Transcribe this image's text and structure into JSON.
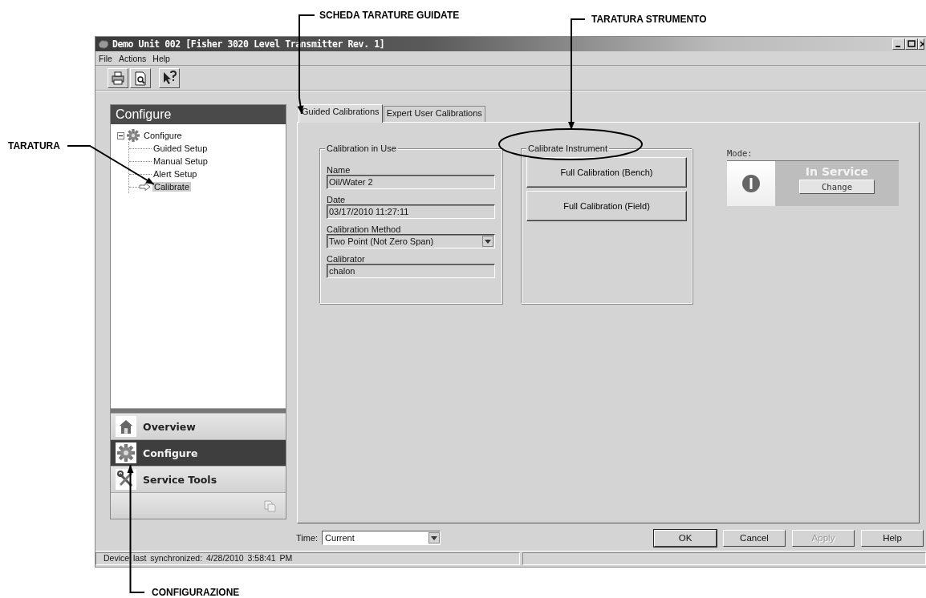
{
  "window": {
    "title": "Demo Unit 002 [Fisher 3020 Level Transmitter Rev. 1]"
  },
  "menu": [
    "File",
    "Actions",
    "Help"
  ],
  "sidebar": {
    "title": "Configure",
    "tree": [
      {
        "label": "Configure",
        "expanded": true,
        "selected": false,
        "children": [
          {
            "label": "Guided Setup",
            "selected": false
          },
          {
            "label": "Manual Setup",
            "selected": false
          },
          {
            "label": "Alert Setup",
            "selected": false
          },
          {
            "label": "Calibrate",
            "selected": true
          }
        ]
      }
    ],
    "nav": [
      {
        "label": "Overview",
        "kind": "home",
        "selected": false
      },
      {
        "label": "Configure",
        "kind": "gear",
        "selected": true
      },
      {
        "label": "Service Tools",
        "kind": "tools",
        "selected": false
      }
    ]
  },
  "tabs": [
    {
      "label": "Guided Calibrations",
      "selected": true
    },
    {
      "label": "Expert User Calibrations",
      "selected": false
    }
  ],
  "calibration_in_use": {
    "title": "Calibration in Use",
    "fields": [
      {
        "label": "Name",
        "value": "Oil/Water 2",
        "kind": "text"
      },
      {
        "label": "Date",
        "value": "03/17/2010 11:27:11",
        "kind": "text"
      },
      {
        "label": "Calibration Method",
        "value": "Two Point (Not Zero Span)",
        "kind": "dropdown"
      },
      {
        "label": "Calibrator",
        "value": "chalon",
        "kind": "text"
      }
    ]
  },
  "calibrate_instrument": {
    "title": "Calibrate Instrument",
    "buttons": [
      "Full Calibration (Bench)",
      "Full Calibration (Field)"
    ]
  },
  "mode": {
    "label": "Mode:",
    "status": "In Service",
    "button": "Change"
  },
  "time": {
    "label": "Time:",
    "value": "Current"
  },
  "buttons": [
    {
      "label": "OK",
      "default": true,
      "disabled": false
    },
    {
      "label": "Cancel",
      "default": false,
      "disabled": false
    },
    {
      "label": "Apply",
      "default": false,
      "disabled": true
    },
    {
      "label": "Help",
      "default": false,
      "disabled": false
    }
  ],
  "status_bar": [
    "Device last synchronized: 4/28/2010 3:58:41 PM"
  ],
  "annotations": [
    {
      "text": "SCHEDA TARATURE GUIDATE",
      "circled": false
    },
    {
      "text": "TARATURA STRUMENTO",
      "circled": true
    },
    {
      "text": "TARATURA",
      "circled": false
    },
    {
      "text": "CONFIGURAZIONE",
      "circled": false
    }
  ]
}
